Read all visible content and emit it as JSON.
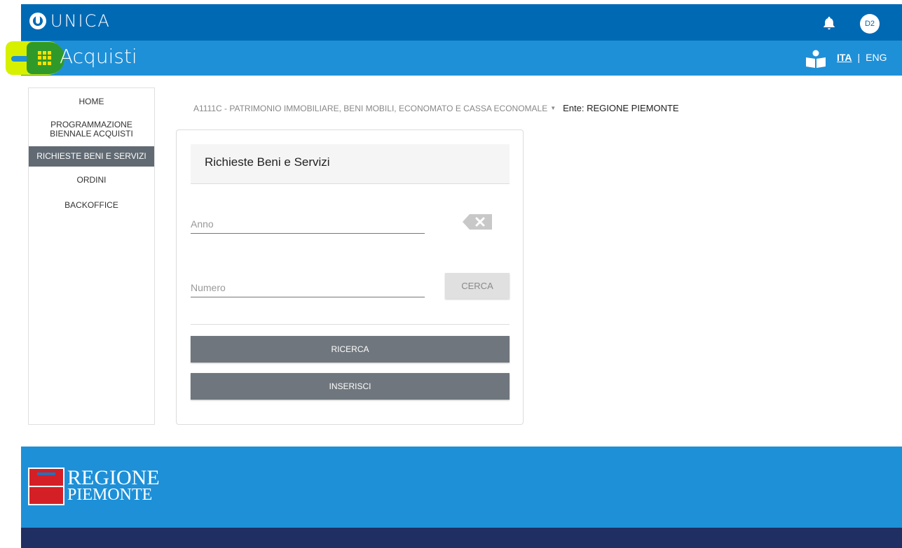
{
  "header": {
    "brand": "UNICA",
    "avatar_initials": "D2",
    "icons": {
      "notifications": "bell-icon",
      "brand": "unica-logo-icon"
    }
  },
  "appbar": {
    "title": "Acquisti",
    "menu_icon": "apps-grid-icon",
    "reader_icon": "reader-icon",
    "lang_ita": "ITA",
    "lang_sep": "|",
    "lang_eng": "ENG",
    "highlight_colors": {
      "yellow": "#d7f000",
      "green": "#2f9a2a"
    }
  },
  "sidebar": {
    "items": [
      {
        "label": "HOME"
      },
      {
        "label": "PROGRAMMAZIONE BIENNALE ACQUISTI"
      },
      {
        "label": "RICHIESTE BENI E SERVIZI",
        "active": true
      },
      {
        "label": "ORDINI"
      },
      {
        "label": "BACKOFFICE"
      }
    ]
  },
  "breadcrumb": {
    "structure": "A1111C - PATRIMONIO IMMOBILIARE, BENI MOBILI, ECONOMATO E CASSA ECONOMALE",
    "ente": "Ente: REGIONE PIEMONTE"
  },
  "form": {
    "title": "Richieste Beni e Servizi",
    "anno_placeholder": "Anno",
    "anno_value": "",
    "numero_placeholder": "Numero",
    "numero_value": "",
    "cerca_label": "CERCA",
    "ricerca_label": "RICERCA",
    "inserisci_label": "INSERISCI",
    "clear_icon": "backspace-clear-icon"
  },
  "footer": {
    "region_line1": "REGIONE",
    "region_line2": "PIEMONTE"
  },
  "colors": {
    "topbar": "#0069b4",
    "appbar": "#1e90d8",
    "sidebar_active": "#616a73",
    "button": "#6f767d",
    "footer_dark": "#1f2f63"
  }
}
